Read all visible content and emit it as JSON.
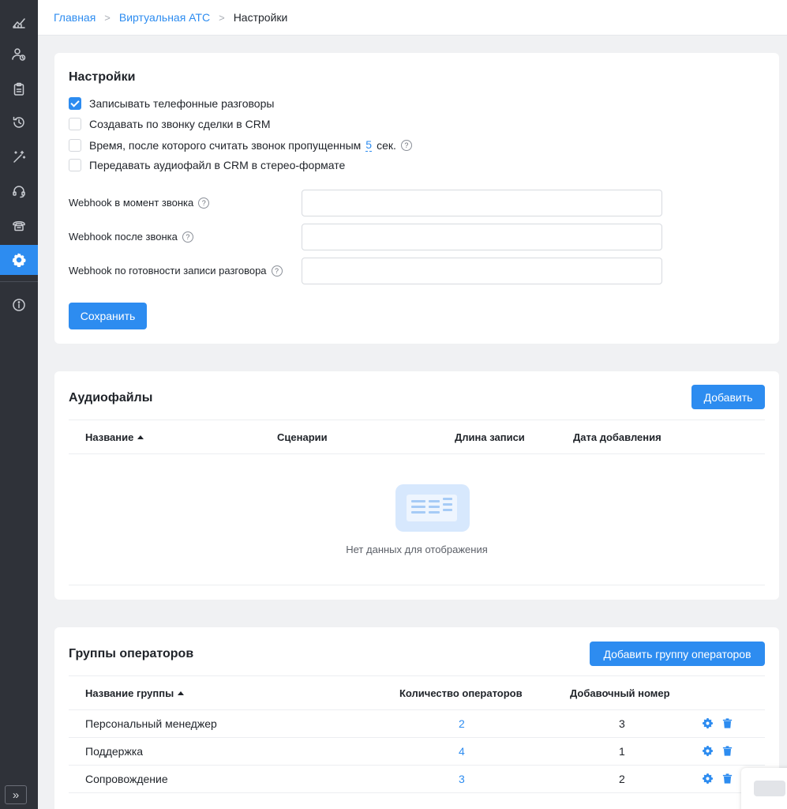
{
  "breadcrumb": {
    "home": "Главная",
    "section": "Виртуальная АТС",
    "current": "Настройки",
    "separator": ">"
  },
  "sidebar": {
    "items": [
      {
        "icon": "analytics-icon"
      },
      {
        "icon": "user-clock-icon"
      },
      {
        "icon": "clipboard-icon"
      },
      {
        "icon": "history-icon"
      },
      {
        "icon": "magic-wand-icon"
      },
      {
        "icon": "headset-icon"
      },
      {
        "icon": "phone-icon"
      },
      {
        "icon": "gear-icon",
        "active": true
      },
      {
        "icon": "info-icon"
      }
    ],
    "expand_label": "»"
  },
  "settings": {
    "title": "Настройки",
    "checkboxes": [
      {
        "label": "Записывать телефонные разговоры",
        "checked": true
      },
      {
        "label": "Создавать по звонку сделки в CRM",
        "checked": false
      },
      {
        "label": "Время, после которого считать звонок пропущенным",
        "checked": false,
        "value": "5",
        "unit": "сек."
      },
      {
        "label": "Передавать аудиофайл в CRM в стерео-формате",
        "checked": false
      }
    ],
    "webhooks": [
      {
        "label": "Webhook в момент звонка",
        "value": ""
      },
      {
        "label": "Webhook после звонка",
        "value": ""
      },
      {
        "label": "Webhook по готовности записи разговора",
        "value": ""
      }
    ],
    "help_glyph": "?",
    "save_label": "Сохранить"
  },
  "audio": {
    "title": "Аудиофайлы",
    "add_label": "Добавить",
    "columns": [
      "Название",
      "Сценарии",
      "Длина записи",
      "Дата добавления"
    ],
    "empty_text": "Нет данных для отображения"
  },
  "groups": {
    "title": "Группы операторов",
    "add_label": "Добавить группу операторов",
    "columns": [
      "Название группы",
      "Количество операторов",
      "Добавочный номер"
    ],
    "rows": [
      {
        "name": "Персональный менеджер",
        "count": "2",
        "ext": "3"
      },
      {
        "name": "Поддержка",
        "count": "4",
        "ext": "1"
      },
      {
        "name": "Сопровождение",
        "count": "3",
        "ext": "2"
      }
    ]
  },
  "colors": {
    "accent": "#2d8cf0",
    "sidebar": "#2f3239",
    "page_bg": "#f0f1f3"
  }
}
